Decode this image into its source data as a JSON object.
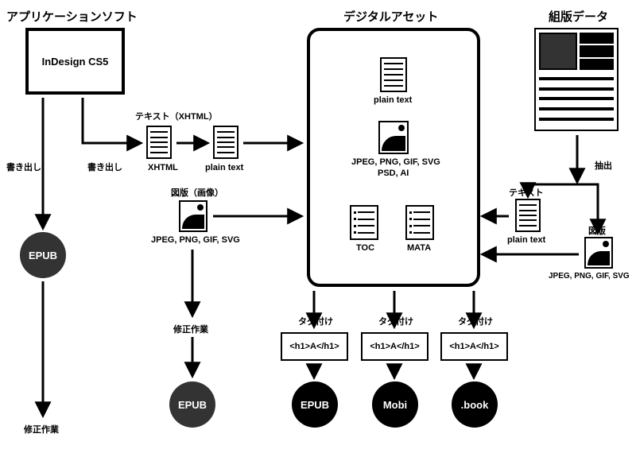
{
  "headings": {
    "app_soft": "アプリケーションソフト",
    "digital_asset": "デジタルアセット",
    "typeset_data": "組版データ"
  },
  "app": {
    "name": "InDesign CS5"
  },
  "labels": {
    "export1": "書き出し",
    "export2": "書き出し",
    "fix_work1": "修正作業",
    "fix_work2": "修正作業",
    "text_xhtml_title": "テキスト（XHTML）",
    "img_title": "図版（画像）",
    "extract": "抽出",
    "text_right": "テキスト",
    "img_right": "図版",
    "tag1": "タグ付け",
    "tag2": "タグ付け",
    "tag3": "タグ付け"
  },
  "captions": {
    "xhtml": "XHTML",
    "plaintext1": "plain text",
    "plaintext_center": "plain text",
    "plaintext_right": "plain text",
    "jpeg1": "JPEG, PNG, GIF, SVG",
    "jpeg_center1": "JPEG, PNG, GIF, SVG",
    "jpeg_center2": "PSD, AI",
    "jpeg_right": "JPEG, PNG, GIF, SVG",
    "toc": "TOC",
    "mata": "MATA"
  },
  "tagbox": {
    "t1": "<h1>A</h1>",
    "t2": "<h1>A</h1>",
    "t3": "<h1>A</h1>"
  },
  "circles": {
    "epub1": "EPUB",
    "epub2": "EPUB",
    "out1": "EPUB",
    "out2": "Mobi",
    "out3": ".book"
  }
}
